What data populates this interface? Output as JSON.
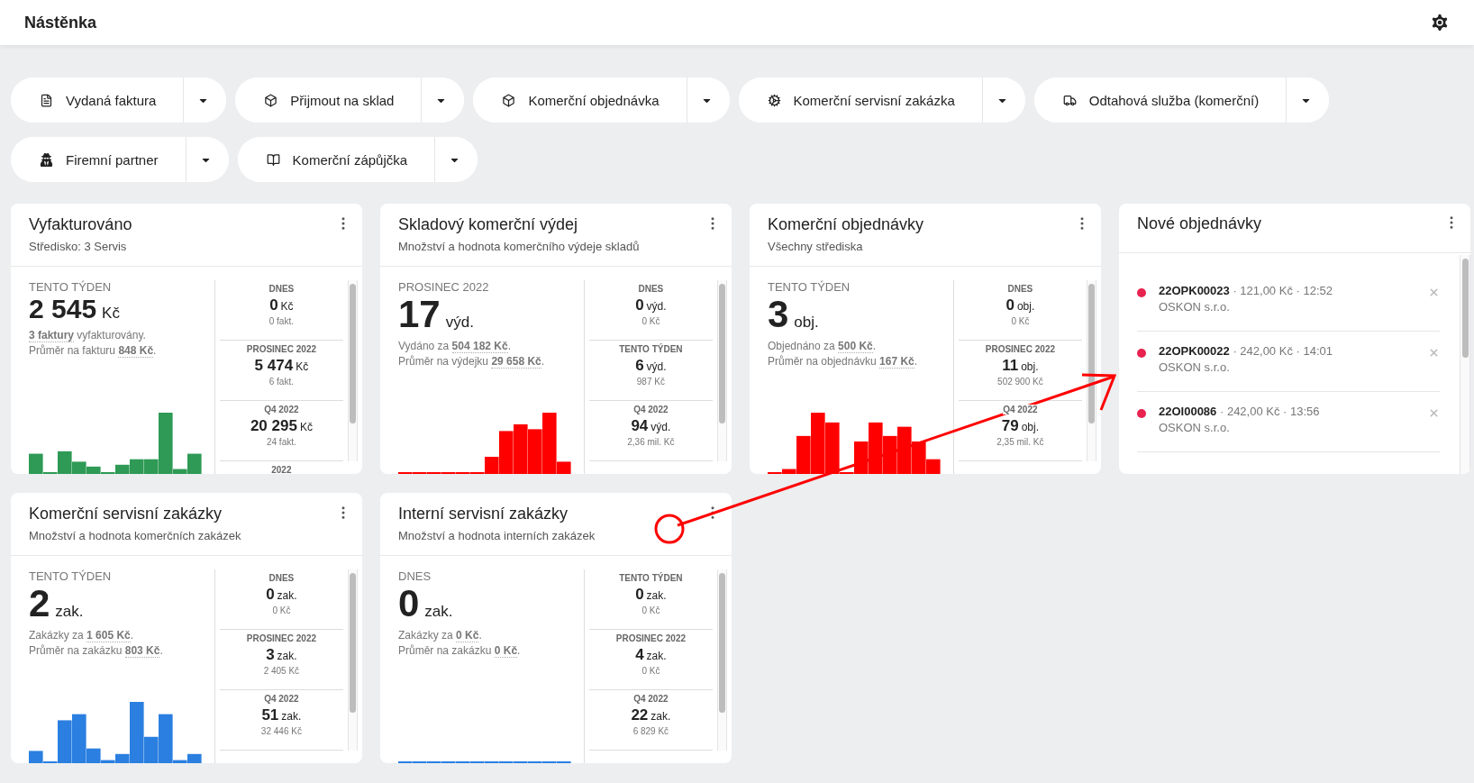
{
  "header": {
    "title": "Nástěnka"
  },
  "quick_actions": [
    {
      "label": "Vydaná faktura"
    },
    {
      "label": "Přijmout na sklad"
    },
    {
      "label": "Komerční objednávka"
    },
    {
      "label": "Komerční servisní zakázka"
    },
    {
      "label": "Odtahová služba (komerční)"
    },
    {
      "label": "Firemní partner"
    },
    {
      "label": "Komerční zápůjčka"
    }
  ],
  "cards": [
    {
      "kind": "stats",
      "title": "Vyfakturováno",
      "subtitle": "Středisko: 3 Servis",
      "color": "#2e9a55",
      "main": {
        "period": "TENTO TÝDEN",
        "value": "2 545",
        "unit": "Kč",
        "lines": [
          "**3 faktury** vyfakturovány.",
          "Průměr na fakturu **848 Kč**."
        ]
      },
      "side": [
        {
          "period": "DNES",
          "value": "0",
          "unit": "Kč",
          "sub": "0 fakt."
        },
        {
          "period": "PROSINEC 2022",
          "value": "5 474",
          "unit": "Kč",
          "sub": "6 fakt."
        },
        {
          "period": "Q4 2022",
          "value": "20 295",
          "unit": "Kč",
          "sub": "24 fakt."
        },
        {
          "period": "2022"
        }
      ]
    },
    {
      "kind": "stats",
      "title": "Skladový komerční výdej",
      "subtitle": "Množství a hodnota komerčního výdeje skladů",
      "color": "#ff0000",
      "main": {
        "period": "PROSINEC 2022",
        "value": "17",
        "unit": "výd.",
        "lines": [
          "Vydáno za **504 182 Kč**.",
          "Průměr na výdejku **29 658 Kč**."
        ]
      },
      "side": [
        {
          "period": "DNES",
          "value": "0",
          "unit": "výd.",
          "sub": "0 Kč"
        },
        {
          "period": "TENTO TÝDEN",
          "value": "6",
          "unit": "výd.",
          "sub": "987 Kč"
        },
        {
          "period": "Q4 2022",
          "value": "94",
          "unit": "výd.",
          "sub": "2,36 mil. Kč"
        }
      ]
    },
    {
      "kind": "stats",
      "title": "Komerční objednávky",
      "subtitle": "Všechny střediska",
      "color": "#ff0000",
      "main": {
        "period": "TENTO TÝDEN",
        "value": "3",
        "unit": "obj.",
        "lines": [
          "Objednáno za **500 Kč**.",
          "Průměr na objednávku **167 Kč**."
        ]
      },
      "side": [
        {
          "period": "DNES",
          "value": "0",
          "unit": "obj.",
          "sub": "0 Kč"
        },
        {
          "period": "PROSINEC 2022",
          "value": "11",
          "unit": "obj.",
          "sub": "502 900 Kč"
        },
        {
          "period": "Q4 2022",
          "value": "79",
          "unit": "obj.",
          "sub": "2,35 mil. Kč"
        }
      ]
    },
    {
      "kind": "list",
      "title": "Nové objednávky",
      "orders": [
        {
          "line": "**22OPK00023** · 121,00 Kč · 12:52",
          "company": "OSKON s.r.o.",
          "color": "#e8234f"
        },
        {
          "line": "**22OPK00022** · 242,00 Kč · 14:01",
          "company": "OSKON s.r.o.",
          "color": "#e8234f"
        },
        {
          "line": "**22OI00086** · 242,00 Kč · 13:56",
          "company": "OSKON s.r.o.",
          "color": "#e8234f"
        }
      ]
    },
    {
      "kind": "stats",
      "title": "Komerční servisní zakázky",
      "subtitle": "Množství a hodnota komerčních zakázek",
      "color": "#2a7fe0",
      "main": {
        "period": "TENTO TÝDEN",
        "value": "2",
        "unit": "zak.",
        "lines": [
          "Zakázky za **1 605 Kč**.",
          "Průměr na zakázku **803 Kč**."
        ]
      },
      "side": [
        {
          "period": "DNES",
          "value": "0",
          "unit": "zak.",
          "sub": "0 Kč"
        },
        {
          "period": "PROSINEC 2022",
          "value": "3",
          "unit": "zak.",
          "sub": "2 405 Kč"
        },
        {
          "period": "Q4 2022",
          "value": "51",
          "unit": "zak.",
          "sub": "32 446 Kč"
        }
      ]
    },
    {
      "kind": "stats",
      "title": "Interní servisní zakázky",
      "subtitle": "Množství a hodnota interních zakázek",
      "color": "#2a7fe0",
      "main": {
        "period": "DNES",
        "value": "0",
        "unit": "zak.",
        "lines": [
          "Zakázky za **0 Kč**.",
          "Průměr na zakázku **0 Kč**."
        ]
      },
      "side": [
        {
          "period": "TENTO TÝDEN",
          "value": "0",
          "unit": "zak.",
          "sub": "0 Kč"
        },
        {
          "period": "PROSINEC 2022",
          "value": "4",
          "unit": "zak.",
          "sub": "0 Kč"
        },
        {
          "period": "Q4 2022",
          "value": "22",
          "unit": "zak.",
          "sub": "6 829 Kč"
        }
      ]
    }
  ]
}
